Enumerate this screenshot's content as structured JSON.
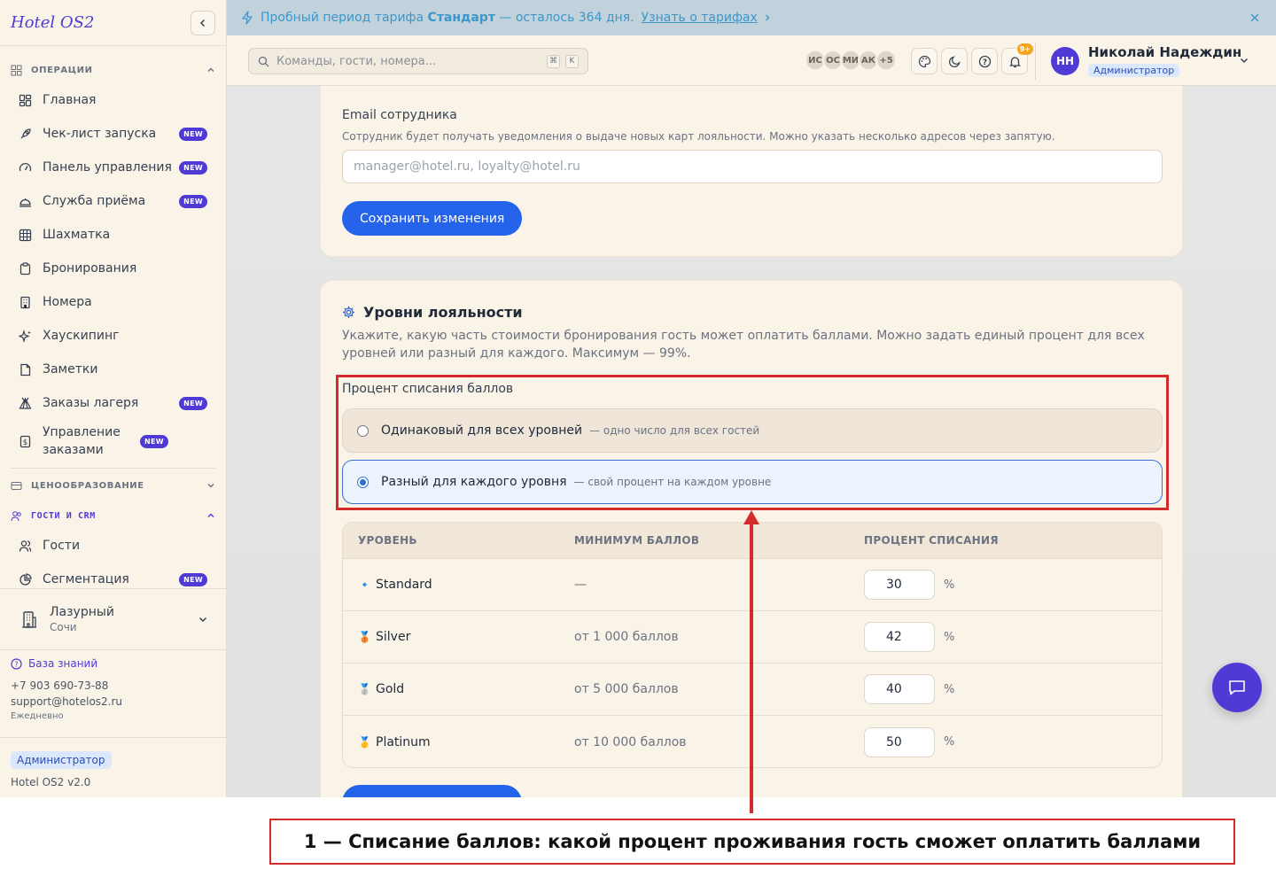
{
  "sidebar": {
    "logo": "Hotel OS2",
    "sections": {
      "operations": "ОПЕРАЦИИ",
      "pricing": "ЦЕНООБРАЗОВАНИЕ",
      "guests_crm": "ГОСТИ И CRM"
    },
    "items": [
      {
        "label": "Главная",
        "icon": "dashboard-icon"
      },
      {
        "label": "Чек-лист запуска",
        "icon": "rocket-icon",
        "badge": "NEW"
      },
      {
        "label": "Панель управления",
        "icon": "gauge-icon",
        "badge": "NEW"
      },
      {
        "label": "Служба приёма",
        "icon": "bell-desk-icon",
        "badge": "NEW"
      },
      {
        "label": "Шахматка",
        "icon": "grid-icon"
      },
      {
        "label": "Бронирования",
        "icon": "clipboard-icon"
      },
      {
        "label": "Номера",
        "icon": "building-icon"
      },
      {
        "label": "Хаускипинг",
        "icon": "sparkles-icon"
      },
      {
        "label": "Заметки",
        "icon": "note-icon"
      },
      {
        "label": "Заказы лагеря",
        "icon": "tent-icon",
        "badge": "NEW"
      },
      {
        "label": "Управление заказами",
        "icon": "receipt-icon",
        "badge": "NEW"
      },
      {
        "label": "Гости",
        "icon": "users-icon"
      },
      {
        "label": "Сегментация",
        "icon": "pie-chart-icon",
        "badge": "NEW"
      }
    ],
    "hotel": {
      "name": "Лазурный",
      "city": "Сочи"
    },
    "support": {
      "kb": "База знаний",
      "phone": "+7 903 690-73-88",
      "email": "support@hotelos2.ru",
      "hours": "Ежедневно"
    },
    "role": "Администратор",
    "version": "Hotel OS2 v2.0"
  },
  "banner": {
    "prefix": "Пробный период тарифа",
    "plan": "Стандарт",
    "suffix": "— осталось 364 дня.",
    "link": "Узнать о тарифах"
  },
  "topbar": {
    "search_placeholder": "Команды, гости, номера...",
    "kbd1": "⌘",
    "kbd2": "K",
    "presence": [
      "ИС",
      "ОС",
      "МИ",
      "АК",
      "+5"
    ],
    "notif_count": "9+",
    "user_initials": "НН",
    "user_name": "Николай Надеждин",
    "user_role": "Администратор"
  },
  "staff_card": {
    "email_label": "Email сотрудника",
    "email_hint": "Сотрудник будет получать уведомления о выдаче новых карт лояльности. Можно указать несколько адресов через запятую.",
    "email_placeholder": "manager@hotel.ru, loyalty@hotel.ru",
    "save": "Сохранить изменения"
  },
  "loyalty": {
    "title": "Уровни лояльности",
    "description": "Укажите, какую часть стоимости бронирования гость может оплатить баллами. Можно задать единый процент для всех уровней или разный для каждого. Максимум — 99%.",
    "pct_label": "Процент списания баллов",
    "option_same": {
      "label": "Одинаковый для всех уровней",
      "hint": "— одно число для всех гостей"
    },
    "option_each": {
      "label": "Разный для каждого уровня",
      "hint": "— свой процент на каждом уровне"
    },
    "table": {
      "headers": [
        "УРОВЕНЬ",
        "МИНИМУМ БАЛЛОВ",
        "ПРОЦЕНТ СПИСАНИЯ"
      ],
      "rows": [
        {
          "level": "Standard",
          "min": "—",
          "pct": "30",
          "medal": "🔹"
        },
        {
          "level": "Silver",
          "min": "от 1 000 баллов",
          "pct": "42",
          "medal": "🥉"
        },
        {
          "level": "Gold",
          "min": "от 5 000 баллов",
          "pct": "40",
          "medal": "🥈"
        },
        {
          "level": "Platinum",
          "min": "от 10 000 баллов",
          "pct": "50",
          "medal": "🥇"
        }
      ],
      "pct_sign": "%"
    }
  },
  "annotation": {
    "text": "1 — Списание баллов: какой процент проживания гость сможет оплатить баллами"
  }
}
